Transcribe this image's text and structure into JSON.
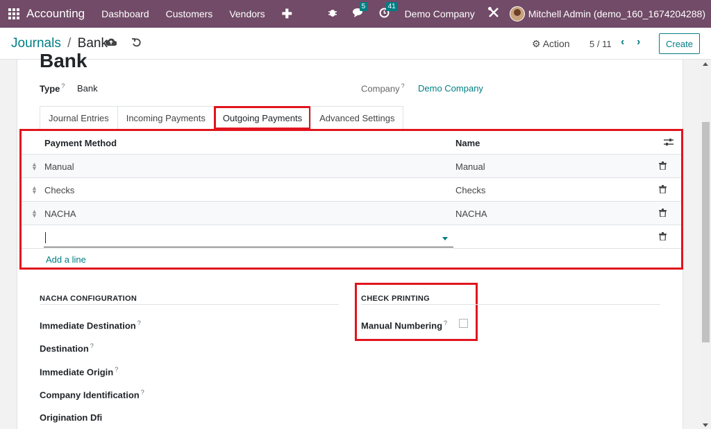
{
  "navbar": {
    "app_name": "Accounting",
    "menu": [
      "Dashboard",
      "Customers",
      "Vendors"
    ],
    "plus": "✚",
    "messages_badge": "5",
    "activities_badge": "41",
    "company": "Demo Company",
    "user": "Mitchell Admin (demo_160_1674204288)"
  },
  "control": {
    "breadcrumb_parent": "Journals",
    "breadcrumb_sep": "/",
    "breadcrumb_current": "Bank",
    "action_label": "Action",
    "action_icon": "⚙",
    "pager": "5 / 11",
    "create_label": "Create"
  },
  "record": {
    "title": "Bank",
    "type_label": "Type",
    "type_value": "Bank",
    "company_label": "Company",
    "company_value": "Demo Company",
    "help_mark": "?"
  },
  "tabs": [
    "Journal Entries",
    "Incoming Payments",
    "Outgoing Payments",
    "Advanced Settings"
  ],
  "payment_table": {
    "headers": {
      "method": "Payment Method",
      "name": "Name"
    },
    "rows": [
      {
        "method": "Manual",
        "name": "Manual"
      },
      {
        "method": "Checks",
        "name": "Checks"
      },
      {
        "method": "NACHA",
        "name": "NACHA"
      }
    ],
    "add_line": "Add a line"
  },
  "nacha": {
    "title": "NACHA CONFIGURATION",
    "fields": [
      "Immediate Destination",
      "Destination",
      "Immediate Origin",
      "Company Identification",
      "Origination Dfi"
    ]
  },
  "check_printing": {
    "title": "CHECK PRINTING",
    "manual_numbering_label": "Manual Numbering",
    "manual_numbering_checked": false
  },
  "colors": {
    "navbar": "#714b67",
    "accent": "#017e84",
    "highlight": "#e1141d"
  }
}
